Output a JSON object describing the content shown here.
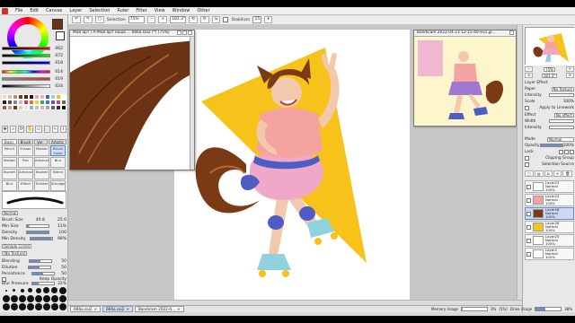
{
  "menubar": {
    "items": [
      "File",
      "Edit",
      "Canvas",
      "Layer",
      "Selection",
      "Ruler",
      "Filter",
      "View",
      "Window",
      "Other"
    ]
  },
  "toolbar": {
    "selection_label": "Selection",
    "zoom_value": "75%",
    "rotation_value": "181.3°",
    "stabilizer_label": "Stabilizer",
    "stabilizer_value": "15"
  },
  "color_sliders": [
    "062",
    "072",
    "018",
    "014",
    "019",
    "024"
  ],
  "tool_tabs": [
    "Basic",
    "Brush",
    "Ver 1",
    "Artistic"
  ],
  "brushes": [
    "Pencil",
    "Eraser",
    "Marker",
    "Brush Color",
    "Marker",
    "Pen",
    "Airbrush",
    "Blur",
    "Bucket",
    "Airbrush",
    "Bucket",
    "Blend",
    "Blur",
    "Effect",
    "Scatter",
    "Smudge"
  ],
  "brush_props": {
    "mode_label": "Normal",
    "size_label": "Brush Size",
    "size_value": "40.8",
    "size_max": "25.0",
    "min_size_label": "Min Size",
    "min_size_value": "11%",
    "density_label": "Density",
    "density_value": "100",
    "min_density_label": "Min Density",
    "min_density_value": "98%",
    "simple_circle_label": "[Simple Circle]",
    "no_texture_label": "[No Texture]",
    "blending_label": "Blending",
    "blending_value": "50",
    "dilution_label": "Dilution",
    "dilution_value": "50",
    "persistence_label": "Persistence",
    "persistence_value": "50",
    "keep_opacity_label": "Keep Opacity",
    "blur_pressure_label": "Blur Pressure",
    "blur_pressure_value": "32%"
  },
  "windows": {
    "main_title": "Мой арт / А-Мой арт наша ... 666a.sai2 (*) (75%)",
    "reference_title": "Bandicam 2022-04-23 12-15-40-931.jp..."
  },
  "right_panel": {
    "zoom_value": "75%",
    "angle_value": "181.3°",
    "layer_effect_label": "Layer Effect",
    "paper_label": "Paper",
    "paper_value": "No Texture",
    "intensity_label": "Intensity",
    "scale_label": "Scale",
    "scale_value": "100%",
    "apply_linework_label": "Apply to Linework",
    "effect_label": "Effect",
    "effect_value": "No effect",
    "width_label": "Width",
    "effect_intensity_label": "Intensity",
    "mode_label": "Mode",
    "mode_value": "Normal",
    "opacity_label": "Opacity",
    "opacity_value": "100%",
    "lock_label": "Lock",
    "clipping_label": "Clipping Group",
    "selection_source_label": "Selection Source"
  },
  "layers": [
    {
      "name": "Layer23",
      "mode": "Normal",
      "opacity": "100%"
    },
    {
      "name": "Layer24",
      "mode": "Normal",
      "opacity": "100%"
    },
    {
      "name": "Layer18",
      "mode": "Normal",
      "opacity": "100%"
    },
    {
      "name": "Layer26",
      "mode": "Normal",
      "opacity": "100%"
    },
    {
      "name": "Layer25",
      "mode": "Normal",
      "opacity": "100%"
    },
    {
      "name": "Layer2",
      "mode": "Normal",
      "opacity": "100%"
    }
  ],
  "taskbar": {
    "tabs": [
      "666a.sai2",
      "666a.sai2",
      "Bandicam 2022-0..."
    ],
    "memory_label": "Memory Usage",
    "memory_value": "3%",
    "memory_detail": "(5%)",
    "drive_label": "Drive Usage",
    "drive_value": "38%"
  },
  "colors": {
    "yellow_triangle": "#f7c21a",
    "hair_brown": "#7a3a14",
    "shirt_pink": "#f5a3a1",
    "skirt_pink": "#f0a8c8",
    "jacket_blue": "#4f5cc2",
    "skates_blue": "#8fd2de",
    "reference_bg": "#fdf6cc"
  }
}
